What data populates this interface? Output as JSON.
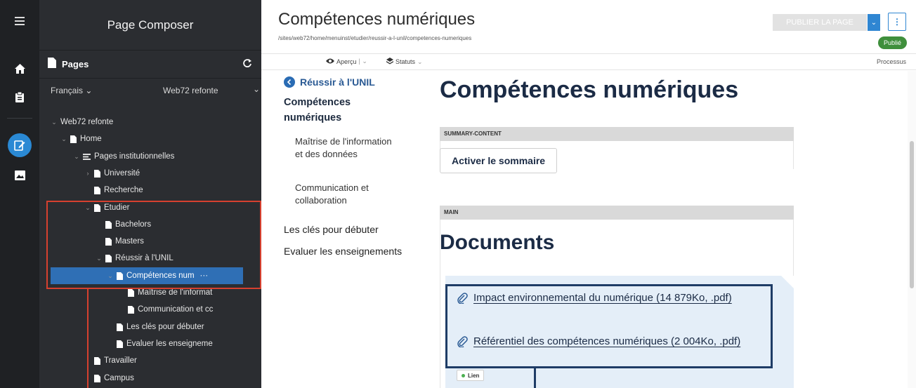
{
  "rail": {
    "items": [
      {
        "icon": "menu-icon"
      },
      {
        "icon": "home-icon"
      },
      {
        "icon": "clipboard-icon"
      },
      {
        "icon": "edit-page-icon"
      },
      {
        "icon": "image-gallery-icon"
      }
    ]
  },
  "composer": {
    "title": "Page Composer",
    "pages_label": "Pages",
    "language": "Français",
    "site": "Web72 refonte",
    "tree": [
      {
        "label": "Web72 refonte",
        "chev": "⌄",
        "icon": ""
      },
      {
        "label": "Home",
        "chev": "⌄",
        "icon": "page"
      },
      {
        "label": "Pages institutionnelles",
        "chev": "⌄",
        "icon": "list"
      },
      {
        "label": "Université",
        "chev": "›",
        "icon": "page"
      },
      {
        "label": "Recherche",
        "chev": "",
        "icon": "page"
      },
      {
        "label": "Etudier",
        "chev": "⌄",
        "icon": "page"
      },
      {
        "label": "Bachelors",
        "chev": "",
        "icon": "page"
      },
      {
        "label": "Masters",
        "chev": "",
        "icon": "page"
      },
      {
        "label": "Réussir à l'UNIL",
        "chev": "⌄",
        "icon": "page"
      },
      {
        "label": "Compétences num",
        "chev": "⌄",
        "icon": "page",
        "selected": true,
        "more": "···"
      },
      {
        "label": "Maîtrise de l'informat",
        "chev": "",
        "icon": "page"
      },
      {
        "label": "Communication et cc",
        "chev": "",
        "icon": "page"
      },
      {
        "label": "Les clés pour débuter",
        "chev": "",
        "icon": "page"
      },
      {
        "label": "Evaluer les enseigneme",
        "chev": "",
        "icon": "page"
      },
      {
        "label": "Travailler",
        "chev": "",
        "icon": "page"
      },
      {
        "label": "Campus",
        "chev": "",
        "icon": "page"
      }
    ]
  },
  "header": {
    "title": "Compétences numériques",
    "path": "/sites/web72/home/menuinst/etudier/reussir-a-l-unil/competences-numeriques",
    "publish_label": "PUBLIER LA PAGE",
    "more_label": "⋮",
    "status": "Publié"
  },
  "toolbar": {
    "preview_label": "Aperçu",
    "statuses_label": "Statuts",
    "process_label": "Processus"
  },
  "preview": {
    "nav": {
      "back_label": "Réussir à l'UNIL",
      "current": "Compétences numériques",
      "sub": [
        "Maîtrise de l'information et des données",
        "Communication et collaboration"
      ],
      "top": [
        "Les clés pour débuter",
        "Evaluer les enseignements"
      ]
    },
    "heading": "Compétences numériques",
    "summary_region": "SUMMARY-CONTENT",
    "summary_button": "Activer le sommaire",
    "main_region": "MAIN",
    "documents_heading": "Documents",
    "documents": [
      {
        "label": "Impact environnemental du numérique (14 879Ko, .pdf)"
      },
      {
        "label": "Référentiel des compétences numériques (2 004Ko, .pdf)"
      }
    ],
    "link_tag": "Lien"
  },
  "colors": {
    "accent": "#2f86d2",
    "highlight_red": "#d6402f",
    "doc_box": "#1e3c66",
    "published": "#3f8f3c"
  }
}
